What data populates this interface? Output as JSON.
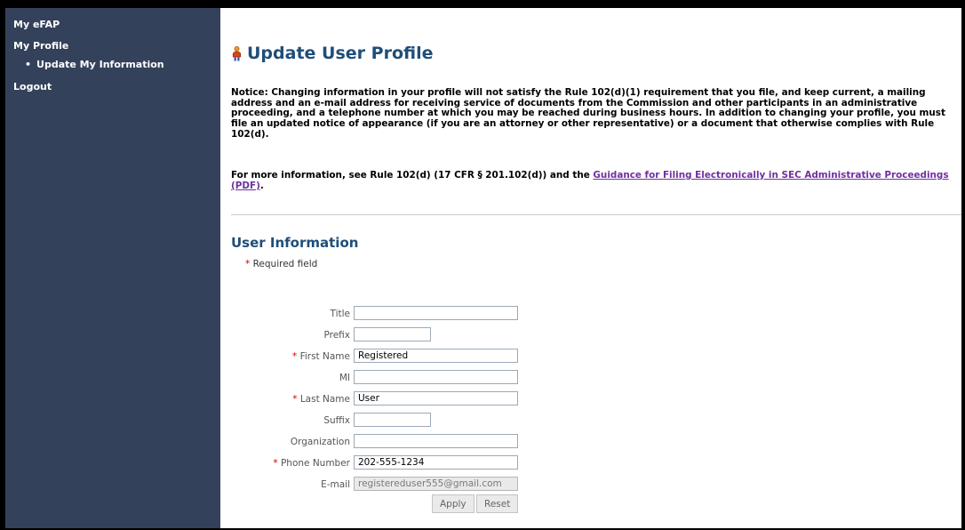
{
  "sidebar": {
    "my_efap": "My eFAP",
    "my_profile": "My Profile",
    "update_info": "Update My Information",
    "logout": "Logout"
  },
  "page": {
    "title": "Update User Profile",
    "notice_text": "Notice: Changing information in your profile will not satisfy the Rule 102(d)(1) requirement that you file, and keep current, a mailing address and an e-mail address for receiving service of documents from the Commission and other participants in an administrative proceeding, and a telephone number at which you may be reached during business hours. In addition to changing your profile, you must file an updated notice of appearance (if you are an attorney or other representative) or a document that otherwise complies with Rule 102(d).",
    "more_info_prefix": "For more information, see Rule 102(d) (17 CFR § 201.102(d)) and the ",
    "guidance_link": "Guidance for Filing Electronically in SEC Administrative Proceedings (PDF)",
    "more_info_suffix": "."
  },
  "form": {
    "section_title": "User Information",
    "required_note": "Required field",
    "required_star": "*",
    "fields": {
      "title": {
        "label": "Title",
        "value": ""
      },
      "prefix": {
        "label": "Prefix",
        "value": ""
      },
      "first_name": {
        "label": "First Name",
        "value": "Registered"
      },
      "mi": {
        "label": "MI",
        "value": ""
      },
      "last_name": {
        "label": "Last Name",
        "value": "User"
      },
      "suffix": {
        "label": "Suffix",
        "value": ""
      },
      "organization": {
        "label": "Organization",
        "value": ""
      },
      "phone": {
        "label": "Phone Number",
        "value": "202-555-1234"
      },
      "email": {
        "label": "E-mail",
        "value": "registereduser555@gmail.com"
      }
    },
    "apply_label": "Apply",
    "reset_label": "Reset"
  },
  "colors": {
    "sidebar_bg": "#34415a",
    "heading": "#1f4e79",
    "link": "#7030a0",
    "required": "#cc0000"
  }
}
